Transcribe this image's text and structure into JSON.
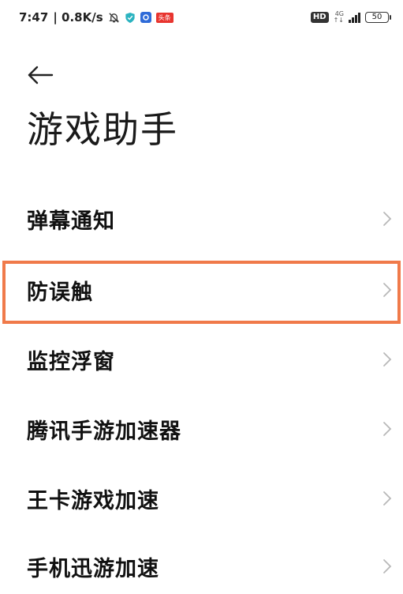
{
  "status_bar": {
    "time": "7:47",
    "speed": "| 0.8K/s",
    "toutiao_badge": "头条",
    "hd_label": "HD",
    "network_type": "4G",
    "network_sub": "↑↓",
    "battery_level": "50"
  },
  "header": {
    "title": "游戏助手"
  },
  "menu": {
    "items": [
      {
        "label": "弹幕通知"
      },
      {
        "label": "防误触"
      },
      {
        "label": "监控浮窗"
      },
      {
        "label": "腾讯手游加速器"
      },
      {
        "label": "王卡游戏加速"
      },
      {
        "label": "手机迅游加速"
      }
    ]
  },
  "colors": {
    "highlight_border": "#f07a4a",
    "chevron": "#b8b8b8"
  }
}
